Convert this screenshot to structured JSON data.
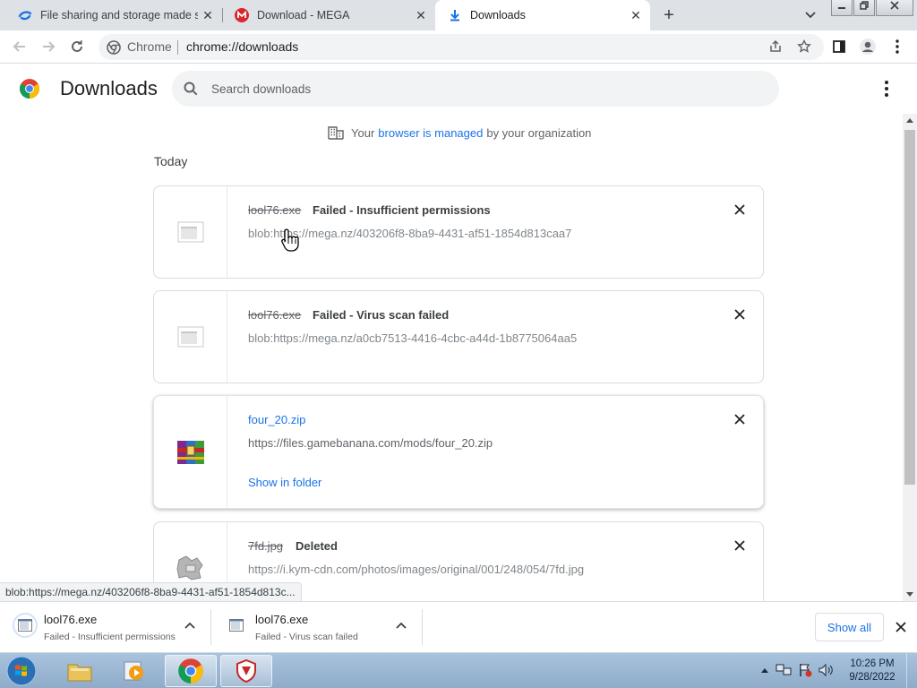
{
  "tabs": [
    {
      "title": "File sharing and storage made simple",
      "icon": "mega-logo-icon"
    },
    {
      "title": "Download - MEGA",
      "icon": "mega-m-icon"
    },
    {
      "title": "Downloads",
      "icon": "download-arrow-icon"
    }
  ],
  "omnibox": {
    "chip": "Chrome",
    "url": "chrome://downloads"
  },
  "page": {
    "title": "Downloads",
    "search_placeholder": "Search downloads",
    "managed": {
      "prefix": "Your",
      "link": "browser is managed",
      "suffix": "by your organization"
    },
    "section": "Today"
  },
  "downloads": [
    {
      "name": "lool76.exe",
      "status": "Failed - Insufficient permissions",
      "url": "blob:https://mega.nz/403206f8-8ba9-4431-af51-1854d813caa7"
    },
    {
      "name": "lool76.exe",
      "status": "Failed - Virus scan failed",
      "url": "blob:https://mega.nz/a0cb7513-4416-4cbc-a44d-1b8775064aa5"
    },
    {
      "name": "four_20.zip",
      "status": "",
      "url": "https://files.gamebanana.com/mods/four_20.zip",
      "action": "Show in folder"
    },
    {
      "name": "7fd.jpg",
      "status": "Deleted",
      "url": "https://i.kym-cdn.com/photos/images/original/001/248/054/7fd.jpg"
    }
  ],
  "status_url": "blob:https://mega.nz/403206f8-8ba9-4431-af51-1854d813c...",
  "shelf": {
    "items": [
      {
        "name": "lool76.exe",
        "status": "Failed - Insufficient permissions"
      },
      {
        "name": "lool76.exe",
        "status": "Failed - Virus scan failed"
      }
    ],
    "show_all": "Show all"
  },
  "taskbar": {
    "time": "10:26 PM",
    "date": "9/28/2022"
  },
  "colors": {
    "accent": "#1a73e8",
    "tabstrip": "#dee1e6",
    "taskbar": "#a9c3dd"
  }
}
